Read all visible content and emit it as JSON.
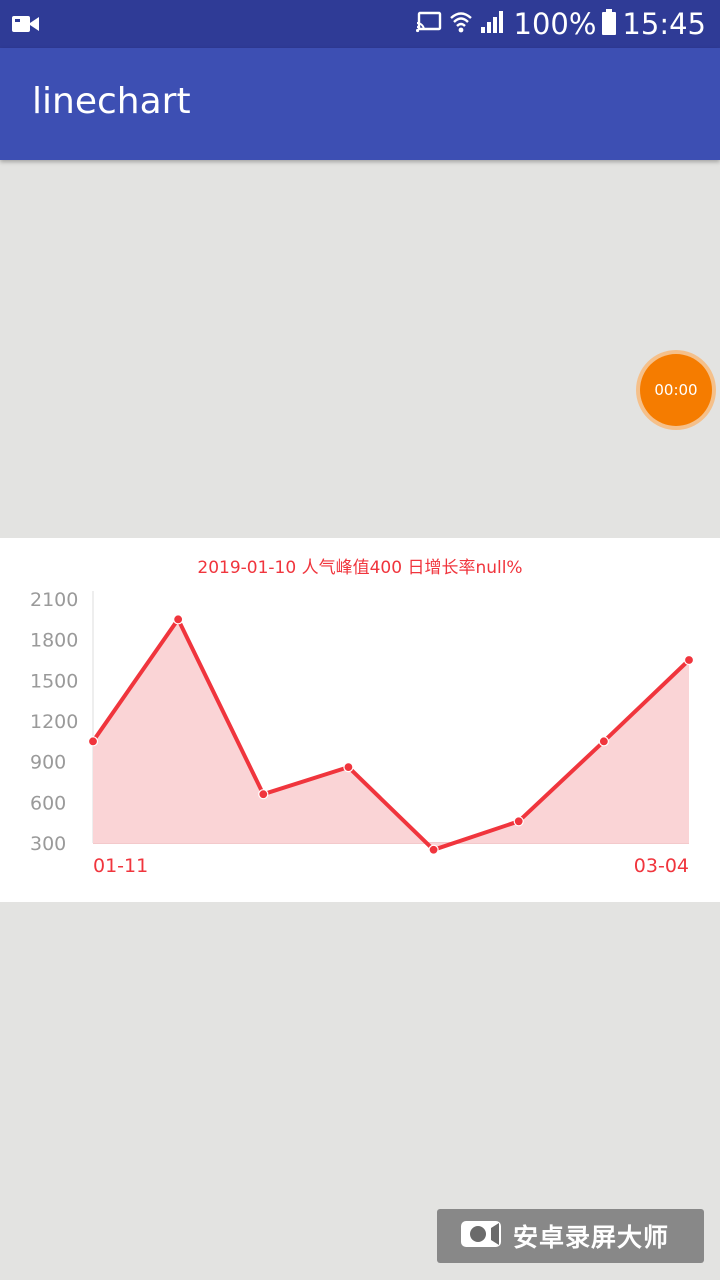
{
  "status_bar": {
    "battery": "100%",
    "time": "15:45",
    "icons": [
      "video-icon",
      "cast-icon",
      "wifi-icon",
      "signal-icon",
      "battery-icon"
    ]
  },
  "app_bar": {
    "title": "linechart"
  },
  "recorder": {
    "timer": "00:00",
    "watermark": "安卓录屏大师"
  },
  "colors": {
    "status_bar": "#2f3b96",
    "app_bar": "#3d4fb3",
    "line": "#f0353d",
    "fill": "#fad4d6",
    "timer": "#f57c00"
  },
  "chart_data": {
    "type": "line",
    "header": "2019-01-10 人气峰值400 日增长率null%",
    "x": [
      "01-11",
      "",
      "",
      "",
      "",
      "",
      "",
      "03-04"
    ],
    "x_tick_labels": [
      "01-11",
      "03-04"
    ],
    "y_ticks": [
      "2100",
      "1800",
      "1500",
      "1200",
      "900",
      "600",
      "300"
    ],
    "ylim": [
      300,
      2100
    ],
    "series": [
      {
        "values": [
          1050,
          1950,
          660,
          860,
          250,
          460,
          1050,
          1650
        ]
      }
    ],
    "fill": true,
    "grid": false
  }
}
